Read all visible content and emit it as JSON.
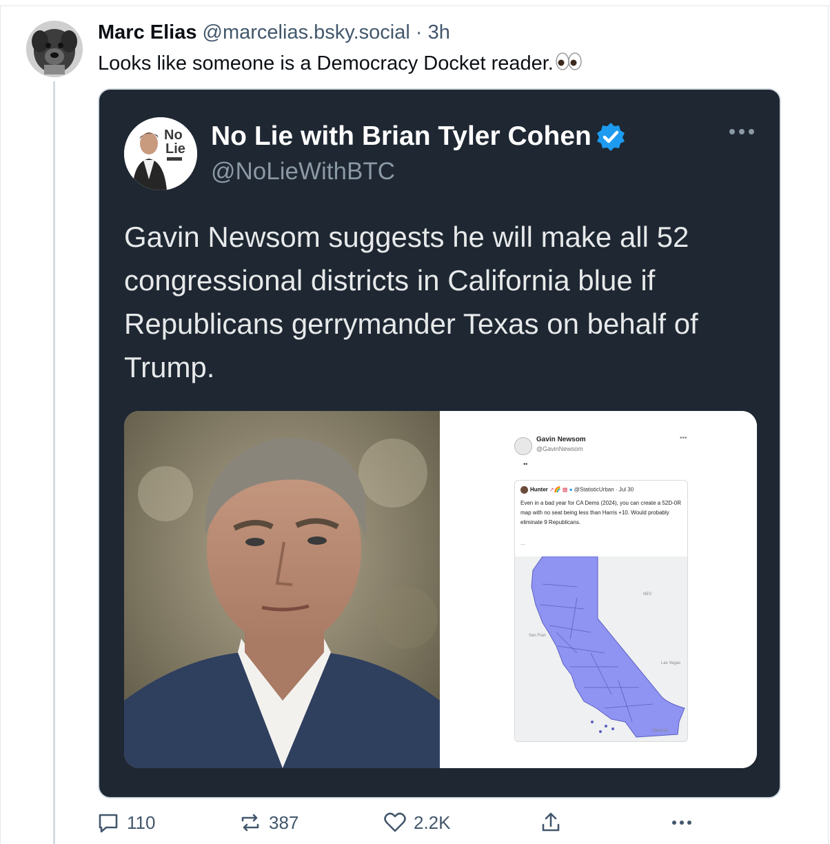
{
  "post": {
    "author_name": "Marc Elias",
    "author_handle": "@marcelias.bsky.social",
    "separator": "·",
    "time": "3h",
    "text": "Looks like someone is a Democracy Docket reader."
  },
  "embed": {
    "name": "No Lie with Brian Tyler Cohen",
    "handle": "@NoLieWithBTC",
    "avatar_logo_line1": "No",
    "avatar_logo_line2": "Lie",
    "text": "Gavin Newsom suggests he will make all 52 congressional districts in California blue if Republicans gerrymander Texas on behalf of Trump.",
    "screenshot": {
      "name": "Gavin Newsom",
      "handle": "@GavinNewsom",
      "reply_dots": "••",
      "quote_author": "Hunter",
      "quote_handle_time": "@StatisticUrban · Jul 30",
      "quote_text": "Even in a bad year for CA Dems (2024), you can create a 52D-0R map with no seat being less than Harris +10. Would probably eliminate 9 Republicans.",
      "quote_ellipsis": "...",
      "map_labels": {
        "nev": "NEV",
        "las_vegas": "Las Vegas",
        "san_francisco": "San Fran",
        "mexicali": "Mexicali"
      }
    }
  },
  "actions": {
    "replies": "110",
    "reposts": "387",
    "likes": "2.2K"
  },
  "colors": {
    "embed_bg": "#1e2732",
    "verified": "#1d9bf0",
    "map_fill": "#8f93f2",
    "meta_text": "#42576c"
  }
}
